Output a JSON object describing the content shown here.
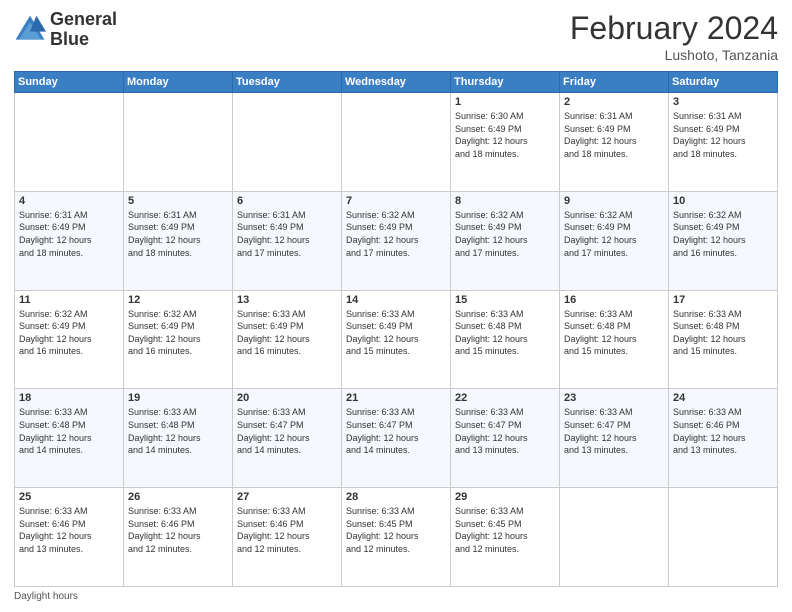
{
  "header": {
    "logo_line1": "General",
    "logo_line2": "Blue",
    "month_title": "February 2024",
    "location": "Lushoto, Tanzania"
  },
  "days_of_week": [
    "Sunday",
    "Monday",
    "Tuesday",
    "Wednesday",
    "Thursday",
    "Friday",
    "Saturday"
  ],
  "footer": {
    "label": "Daylight hours"
  },
  "weeks": [
    [
      {
        "day": "",
        "info": ""
      },
      {
        "day": "",
        "info": ""
      },
      {
        "day": "",
        "info": ""
      },
      {
        "day": "",
        "info": ""
      },
      {
        "day": "1",
        "info": "Sunrise: 6:30 AM\nSunset: 6:49 PM\nDaylight: 12 hours\nand 18 minutes."
      },
      {
        "day": "2",
        "info": "Sunrise: 6:31 AM\nSunset: 6:49 PM\nDaylight: 12 hours\nand 18 minutes."
      },
      {
        "day": "3",
        "info": "Sunrise: 6:31 AM\nSunset: 6:49 PM\nDaylight: 12 hours\nand 18 minutes."
      }
    ],
    [
      {
        "day": "4",
        "info": "Sunrise: 6:31 AM\nSunset: 6:49 PM\nDaylight: 12 hours\nand 18 minutes."
      },
      {
        "day": "5",
        "info": "Sunrise: 6:31 AM\nSunset: 6:49 PM\nDaylight: 12 hours\nand 18 minutes."
      },
      {
        "day": "6",
        "info": "Sunrise: 6:31 AM\nSunset: 6:49 PM\nDaylight: 12 hours\nand 17 minutes."
      },
      {
        "day": "7",
        "info": "Sunrise: 6:32 AM\nSunset: 6:49 PM\nDaylight: 12 hours\nand 17 minutes."
      },
      {
        "day": "8",
        "info": "Sunrise: 6:32 AM\nSunset: 6:49 PM\nDaylight: 12 hours\nand 17 minutes."
      },
      {
        "day": "9",
        "info": "Sunrise: 6:32 AM\nSunset: 6:49 PM\nDaylight: 12 hours\nand 17 minutes."
      },
      {
        "day": "10",
        "info": "Sunrise: 6:32 AM\nSunset: 6:49 PM\nDaylight: 12 hours\nand 16 minutes."
      }
    ],
    [
      {
        "day": "11",
        "info": "Sunrise: 6:32 AM\nSunset: 6:49 PM\nDaylight: 12 hours\nand 16 minutes."
      },
      {
        "day": "12",
        "info": "Sunrise: 6:32 AM\nSunset: 6:49 PM\nDaylight: 12 hours\nand 16 minutes."
      },
      {
        "day": "13",
        "info": "Sunrise: 6:33 AM\nSunset: 6:49 PM\nDaylight: 12 hours\nand 16 minutes."
      },
      {
        "day": "14",
        "info": "Sunrise: 6:33 AM\nSunset: 6:49 PM\nDaylight: 12 hours\nand 15 minutes."
      },
      {
        "day": "15",
        "info": "Sunrise: 6:33 AM\nSunset: 6:48 PM\nDaylight: 12 hours\nand 15 minutes."
      },
      {
        "day": "16",
        "info": "Sunrise: 6:33 AM\nSunset: 6:48 PM\nDaylight: 12 hours\nand 15 minutes."
      },
      {
        "day": "17",
        "info": "Sunrise: 6:33 AM\nSunset: 6:48 PM\nDaylight: 12 hours\nand 15 minutes."
      }
    ],
    [
      {
        "day": "18",
        "info": "Sunrise: 6:33 AM\nSunset: 6:48 PM\nDaylight: 12 hours\nand 14 minutes."
      },
      {
        "day": "19",
        "info": "Sunrise: 6:33 AM\nSunset: 6:48 PM\nDaylight: 12 hours\nand 14 minutes."
      },
      {
        "day": "20",
        "info": "Sunrise: 6:33 AM\nSunset: 6:47 PM\nDaylight: 12 hours\nand 14 minutes."
      },
      {
        "day": "21",
        "info": "Sunrise: 6:33 AM\nSunset: 6:47 PM\nDaylight: 12 hours\nand 14 minutes."
      },
      {
        "day": "22",
        "info": "Sunrise: 6:33 AM\nSunset: 6:47 PM\nDaylight: 12 hours\nand 13 minutes."
      },
      {
        "day": "23",
        "info": "Sunrise: 6:33 AM\nSunset: 6:47 PM\nDaylight: 12 hours\nand 13 minutes."
      },
      {
        "day": "24",
        "info": "Sunrise: 6:33 AM\nSunset: 6:46 PM\nDaylight: 12 hours\nand 13 minutes."
      }
    ],
    [
      {
        "day": "25",
        "info": "Sunrise: 6:33 AM\nSunset: 6:46 PM\nDaylight: 12 hours\nand 13 minutes."
      },
      {
        "day": "26",
        "info": "Sunrise: 6:33 AM\nSunset: 6:46 PM\nDaylight: 12 hours\nand 12 minutes."
      },
      {
        "day": "27",
        "info": "Sunrise: 6:33 AM\nSunset: 6:46 PM\nDaylight: 12 hours\nand 12 minutes."
      },
      {
        "day": "28",
        "info": "Sunrise: 6:33 AM\nSunset: 6:45 PM\nDaylight: 12 hours\nand 12 minutes."
      },
      {
        "day": "29",
        "info": "Sunrise: 6:33 AM\nSunset: 6:45 PM\nDaylight: 12 hours\nand 12 minutes."
      },
      {
        "day": "",
        "info": ""
      },
      {
        "day": "",
        "info": ""
      }
    ]
  ]
}
